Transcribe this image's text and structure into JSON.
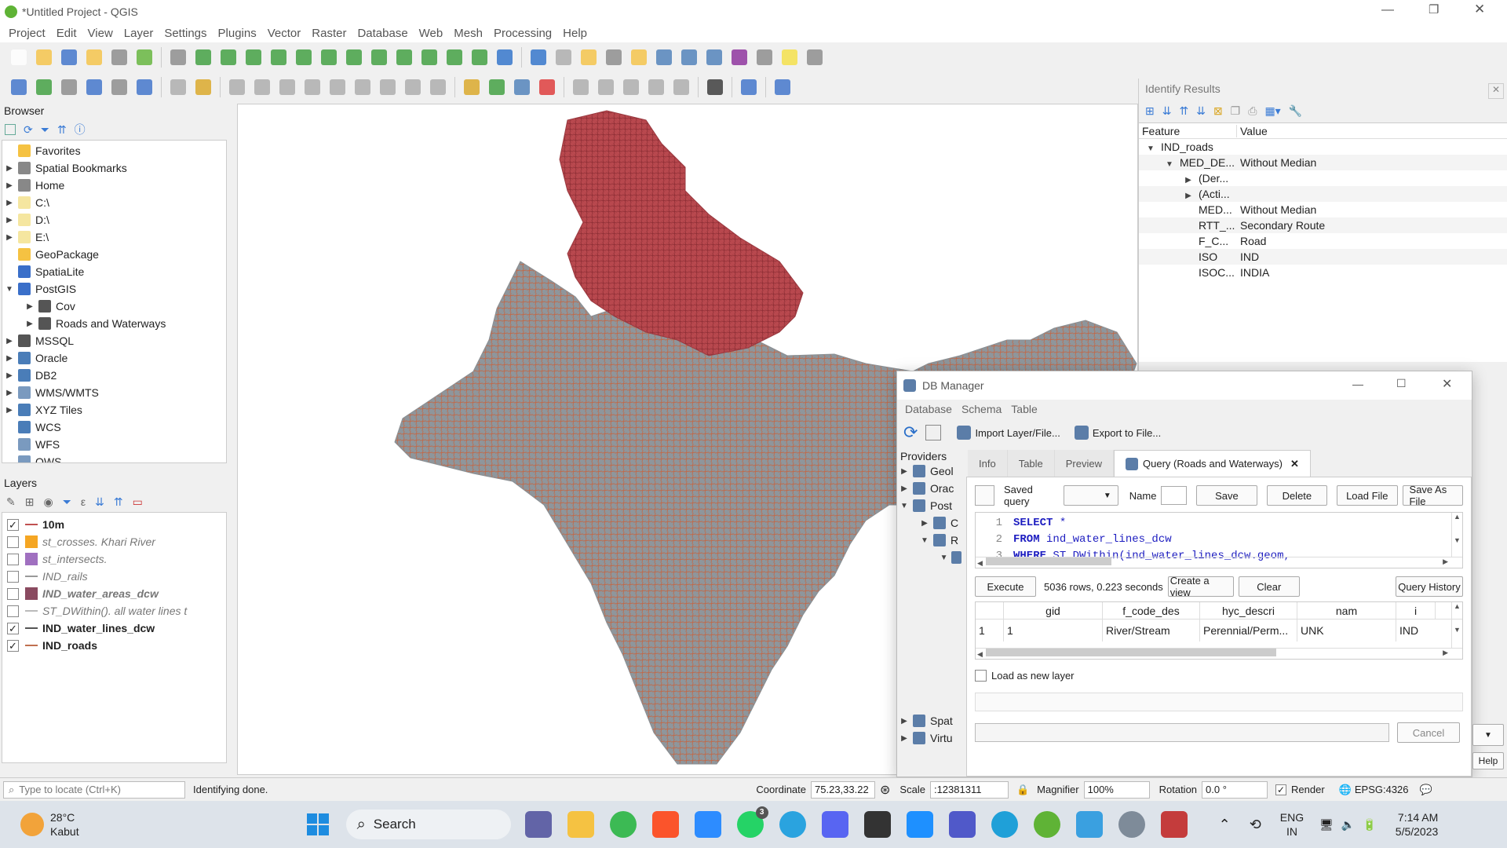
{
  "window": {
    "title": "*Untitled Project - QGIS"
  },
  "menu": [
    "Project",
    "Edit",
    "View",
    "Layer",
    "Settings",
    "Plugins",
    "Vector",
    "Raster",
    "Database",
    "Web",
    "Mesh",
    "Processing",
    "Help"
  ],
  "browser": {
    "title": "Browser",
    "items": [
      {
        "label": "Favorites",
        "icon": "star-icon",
        "arrow": "",
        "indent": 0
      },
      {
        "label": "Spatial Bookmarks",
        "icon": "bookmark-icon",
        "arrow": "▶",
        "indent": 0
      },
      {
        "label": "Home",
        "icon": "home-icon",
        "arrow": "▶",
        "indent": 0
      },
      {
        "label": "C:\\",
        "icon": "folder-icon",
        "arrow": "▶",
        "indent": 0
      },
      {
        "label": "D:\\",
        "icon": "folder-icon",
        "arrow": "▶",
        "indent": 0
      },
      {
        "label": "E:\\",
        "icon": "folder-icon",
        "arrow": "▶",
        "indent": 0
      },
      {
        "label": "GeoPackage",
        "icon": "geopackage-icon",
        "arrow": "",
        "indent": 0
      },
      {
        "label": "SpatiaLite",
        "icon": "spatialite-icon",
        "arrow": "",
        "indent": 0
      },
      {
        "label": "PostGIS",
        "icon": "postgis-icon",
        "arrow": "▼",
        "indent": 0
      },
      {
        "label": "Cov",
        "icon": "connection-icon",
        "arrow": "▶",
        "indent": 1
      },
      {
        "label": "Roads and Waterways",
        "icon": "connection-icon",
        "arrow": "▶",
        "indent": 1
      },
      {
        "label": "MSSQL",
        "icon": "mssql-icon",
        "arrow": "▶",
        "indent": 0
      },
      {
        "label": "Oracle",
        "icon": "oracle-icon",
        "arrow": "▶",
        "indent": 0
      },
      {
        "label": "DB2",
        "icon": "db2-icon",
        "arrow": "▶",
        "indent": 0
      },
      {
        "label": "WMS/WMTS",
        "icon": "wms-icon",
        "arrow": "▶",
        "indent": 0
      },
      {
        "label": "XYZ Tiles",
        "icon": "xyz-icon",
        "arrow": "▶",
        "indent": 0
      },
      {
        "label": "WCS",
        "icon": "wcs-icon",
        "arrow": "",
        "indent": 0
      },
      {
        "label": "WFS",
        "icon": "wfs-icon",
        "arrow": "",
        "indent": 0
      },
      {
        "label": "OWS",
        "icon": "ows-icon",
        "arrow": "",
        "indent": 0
      }
    ]
  },
  "layers": {
    "title": "Layers",
    "items": [
      {
        "label": "10m",
        "checked": "✓",
        "swatch": "#c05050",
        "line": true,
        "bold": true,
        "italic": false
      },
      {
        "label": "st_crosses. Khari River",
        "checked": "",
        "swatch": "#f5a623",
        "line": false,
        "bold": false,
        "italic": true
      },
      {
        "label": "st_intersects.",
        "checked": "",
        "swatch": "#a070c0",
        "line": false,
        "bold": false,
        "italic": true
      },
      {
        "label": "IND_rails",
        "checked": "",
        "swatch": "#999999",
        "line": true,
        "bold": false,
        "italic": true
      },
      {
        "label": "IND_water_areas_dcw",
        "checked": "",
        "swatch": "#8a4a60",
        "line": false,
        "bold": true,
        "italic": true
      },
      {
        "label": "ST_DWithin(). all water lines t",
        "checked": "",
        "swatch": "#bbbbbb",
        "line": true,
        "bold": false,
        "italic": true
      },
      {
        "label": "IND_water_lines_dcw",
        "checked": "✓",
        "swatch": "#555555",
        "line": true,
        "bold": true,
        "italic": false
      },
      {
        "label": "IND_roads",
        "checked": "✓",
        "swatch": "#c07050",
        "line": true,
        "bold": true,
        "italic": false
      }
    ]
  },
  "identify": {
    "title": "Identify Results",
    "col_feature": "Feature",
    "col_value": "Value",
    "rows": [
      {
        "f": "IND_roads",
        "v": "",
        "ind": 0,
        "arrow": "▼"
      },
      {
        "f": "MED_DE...",
        "v": "Without Median",
        "ind": 1,
        "arrow": "▼"
      },
      {
        "f": "(Der...",
        "v": "",
        "ind": 2,
        "arrow": "▶"
      },
      {
        "f": "(Acti...",
        "v": "",
        "ind": 2,
        "arrow": "▶"
      },
      {
        "f": "MED...",
        "v": "Without Median",
        "ind": 2,
        "arrow": ""
      },
      {
        "f": "RTT_...",
        "v": "Secondary Route",
        "ind": 2,
        "arrow": ""
      },
      {
        "f": "F_C...",
        "v": "Road",
        "ind": 2,
        "arrow": ""
      },
      {
        "f": "ISO",
        "v": "IND",
        "ind": 2,
        "arrow": ""
      },
      {
        "f": "ISOC...",
        "v": "INDIA",
        "ind": 2,
        "arrow": ""
      }
    ]
  },
  "dbmanager": {
    "title": "DB Manager",
    "menu": [
      "Database",
      "Schema",
      "Table"
    ],
    "import_label": "Import Layer/File...",
    "export_label": "Export to File...",
    "providers_label": "Providers",
    "providers": [
      {
        "label": "Geol",
        "arrow": "▶",
        "ind": 0
      },
      {
        "label": "Orac",
        "arrow": "▶",
        "ind": 0
      },
      {
        "label": "Post",
        "arrow": "▼",
        "ind": 0
      },
      {
        "label": "C",
        "arrow": "▶",
        "ind": 1
      },
      {
        "label": "R",
        "arrow": "▼",
        "ind": 1
      },
      {
        "label": "",
        "arrow": "▼",
        "ind": 2
      }
    ],
    "providers_bottom": [
      {
        "label": "Spat",
        "arrow": "▶"
      },
      {
        "label": "Virtu",
        "arrow": "▶"
      }
    ],
    "tabs": [
      "Info",
      "Table",
      "Preview"
    ],
    "query_tab": "Query (Roads and Waterways)",
    "saved_query": "Saved query",
    "name_label": "Name",
    "save": "Save",
    "delete": "Delete",
    "load_file": "Load File",
    "save_as_file": "Save As File",
    "sql": [
      {
        "n": "1",
        "kw": "SELECT",
        "rest": " *"
      },
      {
        "n": "2",
        "kw": "FROM",
        "rest": " ind_water_lines_dcw"
      },
      {
        "n": "3",
        "kw": "WHERE",
        "rest": " ST_DWithin(ind_water_lines_dcw.geom,"
      }
    ],
    "execute": "Execute",
    "status": "5036 rows, 0.223 seconds",
    "create_view": "Create a view",
    "clear": "Clear",
    "query_history": "Query History",
    "columns": [
      "gid",
      "f_code_des",
      "hyc_descri",
      "nam",
      "i"
    ],
    "row": {
      "idx": "1",
      "gid": "1",
      "f_code": "River/Stream",
      "hyc": "Perennial/Perm...",
      "nam": "UNK",
      "i": "IND"
    },
    "load_as_layer": "Load as new layer",
    "cancel": "Cancel",
    "help": "Help"
  },
  "statusbar": {
    "locate_placeholder": "Type to locate (Ctrl+K)",
    "message": "Identifying done.",
    "coord_label": "Coordinate",
    "coord": "75.23,33.22",
    "scale_label": "Scale",
    "scale": ":12381311",
    "magnifier_label": "Magnifier",
    "magnifier": "100%",
    "rotation_label": "Rotation",
    "rotation": "0.0 °",
    "render": "Render",
    "crs": "EPSG:4326"
  },
  "taskbar": {
    "temp": "28°C",
    "weather": "Kabut",
    "search": "Search",
    "lang1": "ENG",
    "lang2": "IN",
    "time": "7:14 AM",
    "date": "5/5/2023",
    "badge": "3"
  }
}
